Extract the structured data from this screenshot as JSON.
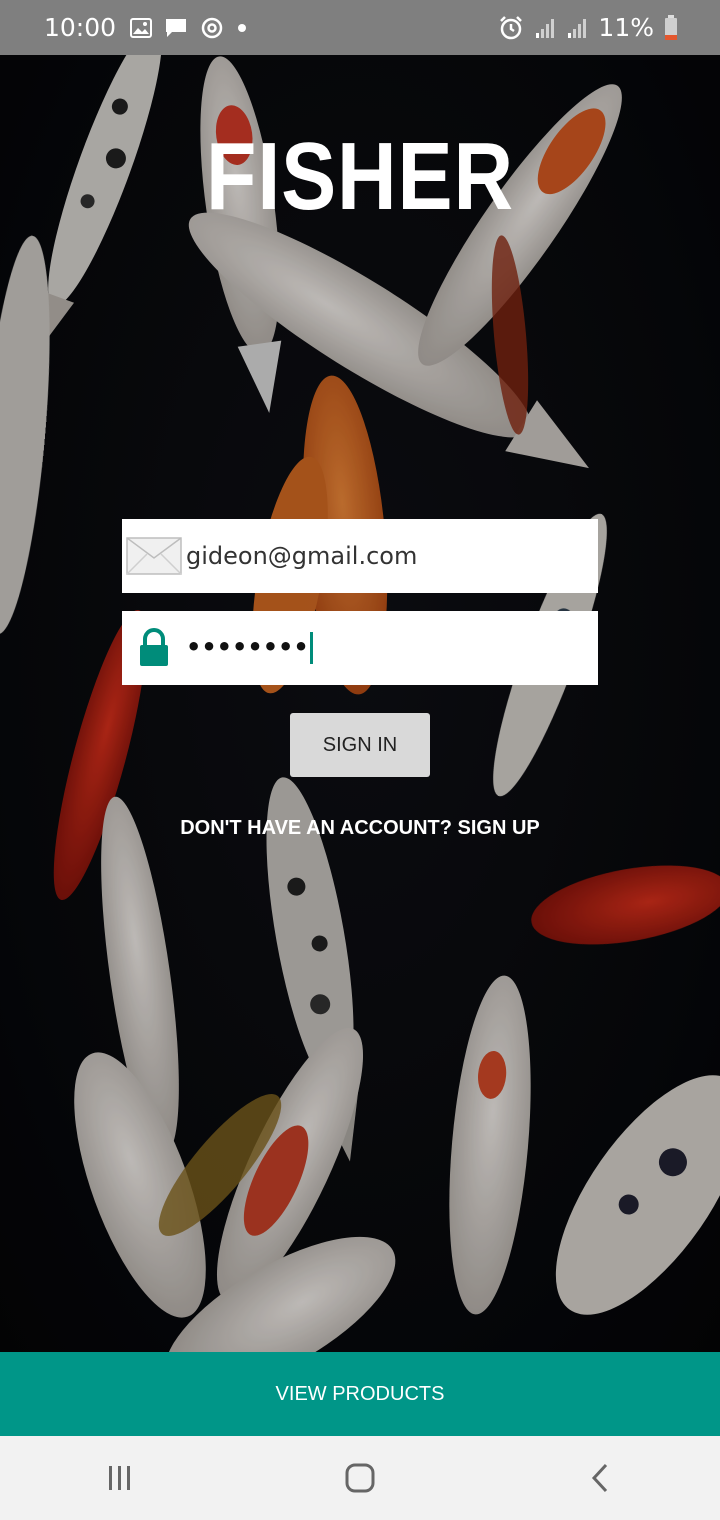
{
  "status_bar": {
    "time": "10:00",
    "battery": "11%",
    "icons": [
      "image-icon",
      "message-icon",
      "sync-icon",
      "dot-icon",
      "alarm-icon",
      "signal-icon",
      "signal-icon",
      "battery-icon"
    ]
  },
  "app": {
    "title": "FISHER"
  },
  "login": {
    "email_value": "gideon@gmail.com",
    "password_value": "••••••••",
    "signin_label": "SIGN IN",
    "signup_text": "DON'T HAVE AN ACCOUNT? SIGN UP"
  },
  "footer": {
    "view_products_label": "VIEW PRODUCTS"
  },
  "nav": {
    "icons": [
      "recent-apps-icon",
      "home-icon",
      "back-icon"
    ]
  },
  "colors": {
    "accent": "#009688",
    "status_bar": "#7f7f7f",
    "button_bg": "#d9d9d9",
    "lock_icon": "#008c7a"
  }
}
